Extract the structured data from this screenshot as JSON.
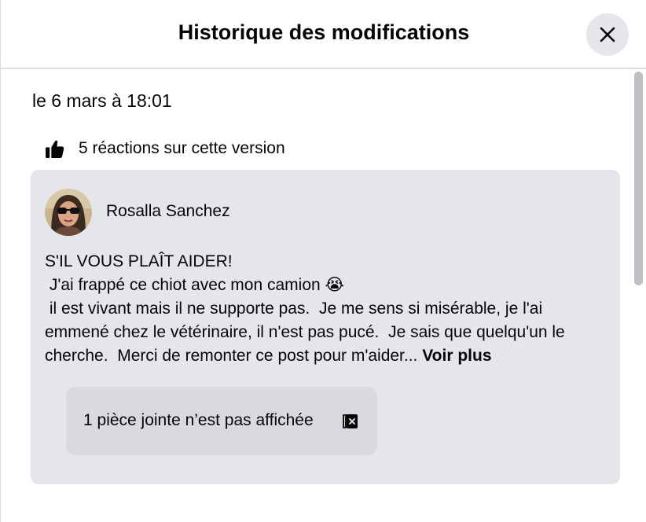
{
  "dialog": {
    "title": "Historique des modifications",
    "close_icon": "close-icon"
  },
  "revision": {
    "date": "le 6 mars à 18:01",
    "reactions_icon": "thumbs-up-icon",
    "reactions_text": "5 réactions sur cette version"
  },
  "post": {
    "author": "Rosalla Sanchez",
    "avatar_icon": "avatar",
    "lines": [
      "S'IL VOUS PLAÎT AIDER!",
      " J'ai frappé ce chiot avec mon camion 😭",
      " il est vivant mais il ne supporte pas.  Je me sens si misérable, je l'ai",
      "emmené chez le vétérinaire, il n'est pas pucé.  Je sais que quelqu'un le",
      "cherche.  Merci de remonter ce post pour m'aider... "
    ],
    "see_more": "Voir plus",
    "attachment_text": "1 pièce jointe n’est pas affichée",
    "attachment_icon": "hidden-attachment-icon"
  },
  "colors": {
    "card_bg": "#e4e6eb",
    "attachment_bg": "#d8dadf",
    "close_bg": "#e4e6eb",
    "scrollbar": "#bcc0c4",
    "text": "#050505"
  }
}
